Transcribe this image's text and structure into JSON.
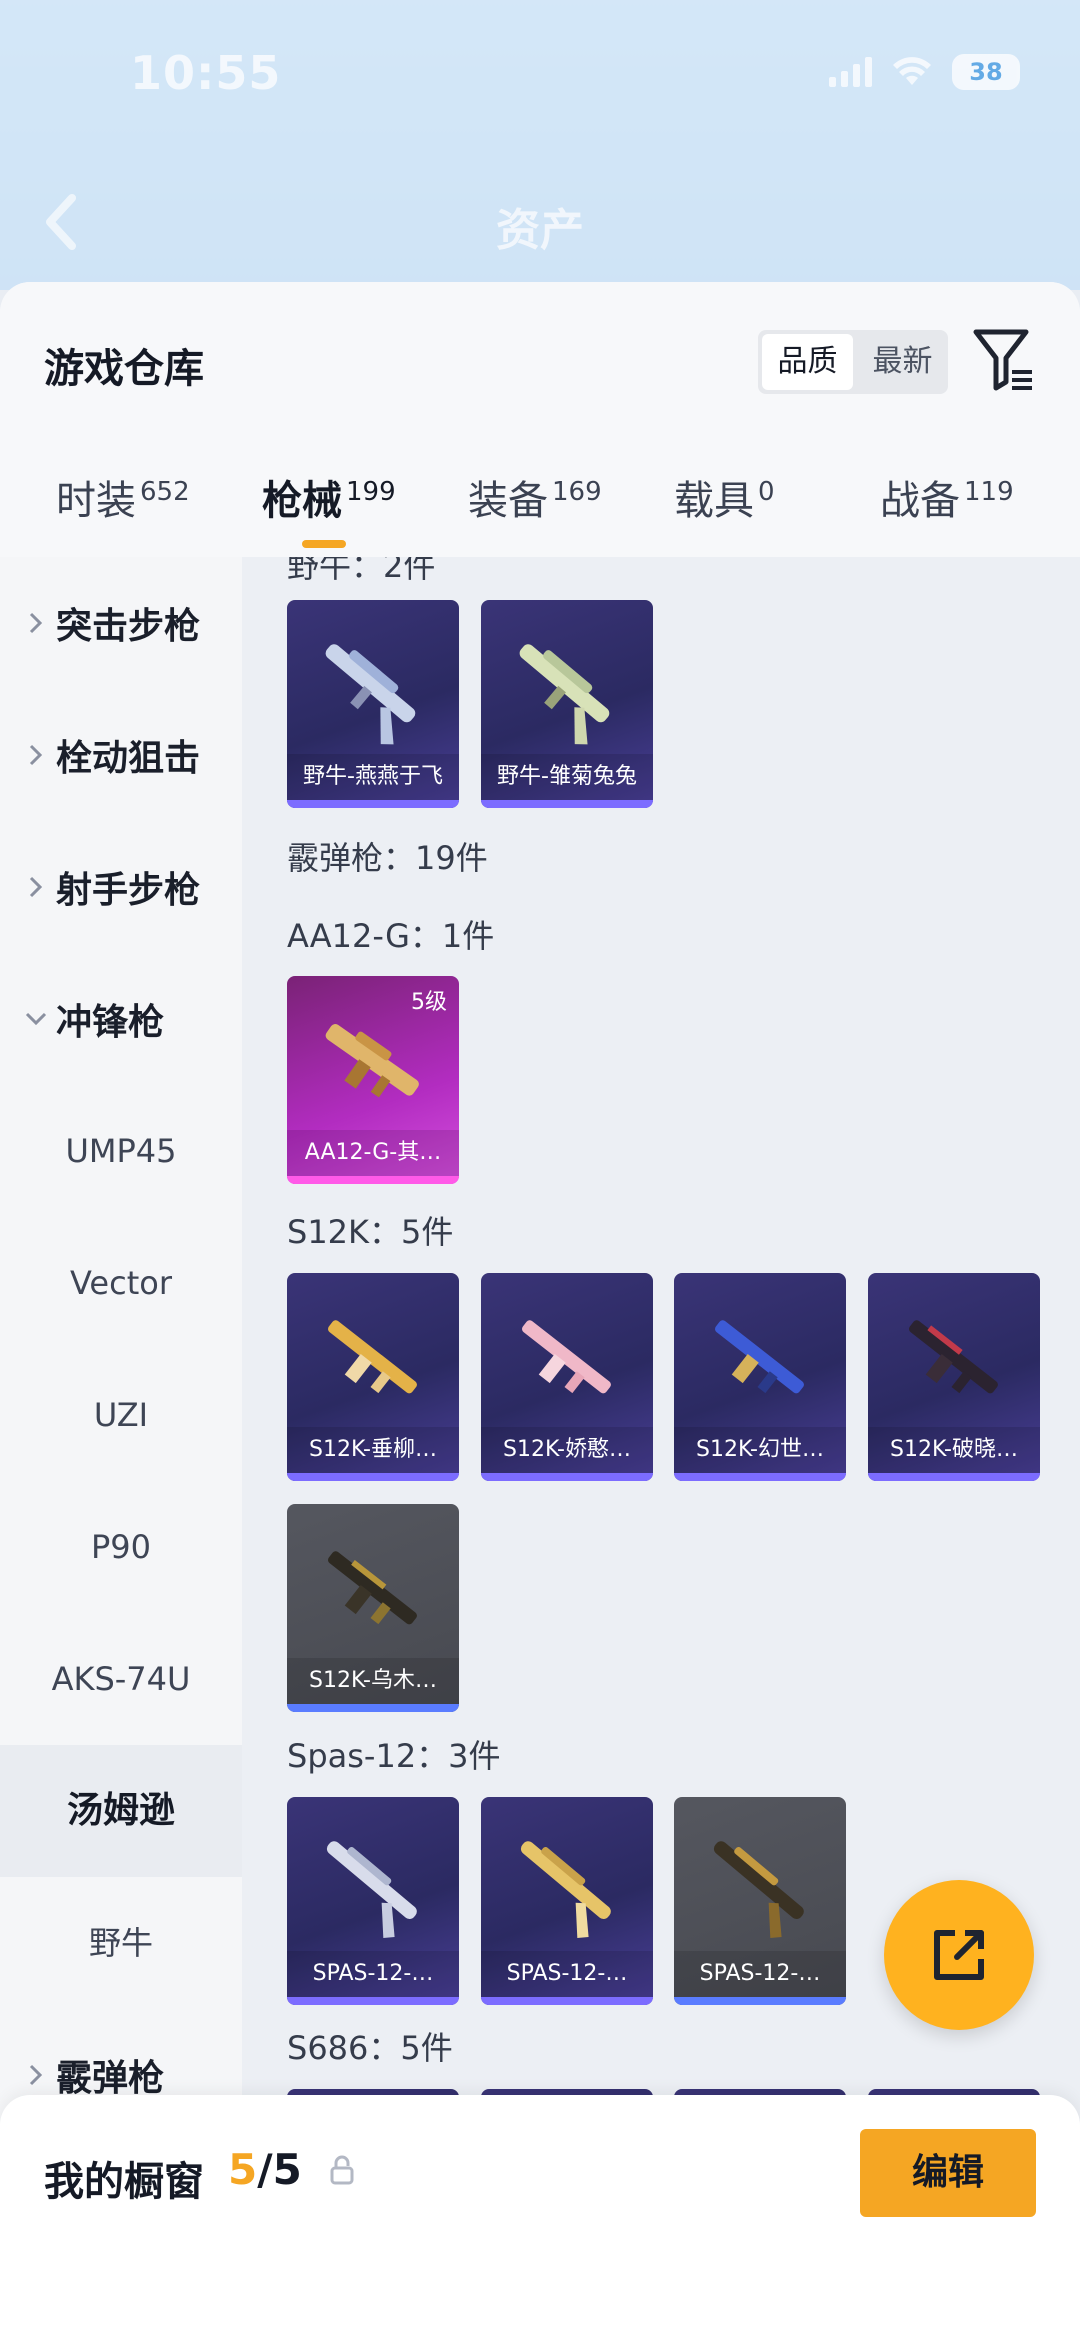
{
  "status_bar": {
    "time": "10:55",
    "battery": "38"
  },
  "header": {
    "title": "资产"
  },
  "sheet": {
    "title": "游戏仓库",
    "sort": {
      "options": [
        "品质",
        "最新"
      ],
      "selected": "品质"
    }
  },
  "tabs": [
    {
      "label": "时装",
      "count": "652"
    },
    {
      "label": "枪械",
      "count": "199",
      "active": true
    },
    {
      "label": "装备",
      "count": "169"
    },
    {
      "label": "载具",
      "count": "0"
    },
    {
      "label": "战备",
      "count": "119"
    }
  ],
  "sidebar": {
    "categories": [
      {
        "label": "突击步枪",
        "expanded": false
      },
      {
        "label": "栓动狙击",
        "expanded": false
      },
      {
        "label": "射手步枪",
        "expanded": false
      },
      {
        "label": "冲锋枪",
        "expanded": true
      },
      {
        "label": "霰弹枪",
        "expanded": false
      }
    ],
    "sub_items": [
      "UMP45",
      "Vector",
      "UZI",
      "P90",
      "AKS-74U",
      "汤姆逊",
      "野牛"
    ],
    "active_sub_item": "汤姆逊"
  },
  "content": {
    "partial_header": "野牛：2件",
    "section_header": "霰弹枪：19件",
    "groups": [
      {
        "title": "野牛：2件",
        "items": [
          {
            "name": "野牛-燕燕于飞",
            "rarity": "purple"
          },
          {
            "name": "野牛-雏菊兔兔",
            "rarity": "purple"
          }
        ]
      },
      {
        "title": "AA12-G：1件",
        "items": [
          {
            "name": "AA12-G-其…",
            "rarity": "pink",
            "level": "5级"
          }
        ]
      },
      {
        "title": "S12K：5件",
        "items": [
          {
            "name": "S12K-垂柳…",
            "rarity": "purple"
          },
          {
            "name": "S12K-娇憨…",
            "rarity": "purple"
          },
          {
            "name": "S12K-幻世…",
            "rarity": "purple"
          },
          {
            "name": "S12K-破晓…",
            "rarity": "purple"
          },
          {
            "name": "S12K-乌木…",
            "rarity": "gray"
          }
        ]
      },
      {
        "title": "Spas-12：3件",
        "items": [
          {
            "name": "SPAS-12-…",
            "rarity": "purple"
          },
          {
            "name": "SPAS-12-…",
            "rarity": "purple"
          },
          {
            "name": "SPAS-12-…",
            "rarity": "gray"
          }
        ]
      },
      {
        "title": "S686：5件",
        "items": []
      }
    ]
  },
  "bottom": {
    "showcase_label": "我的橱窗",
    "showcase_current": "5",
    "showcase_separator": "/",
    "showcase_max": "5",
    "edit_label": "编辑"
  },
  "colors": {
    "accent": "#f5a623",
    "rarity_purple": "#2b2a62",
    "rarity_pink": "#b22cc0",
    "rarity_gray": "#4d4f57"
  },
  "icons": {
    "back": "chevron-left-icon",
    "filter": "filter-icon",
    "share": "share-icon",
    "lock": "lock-icon"
  }
}
